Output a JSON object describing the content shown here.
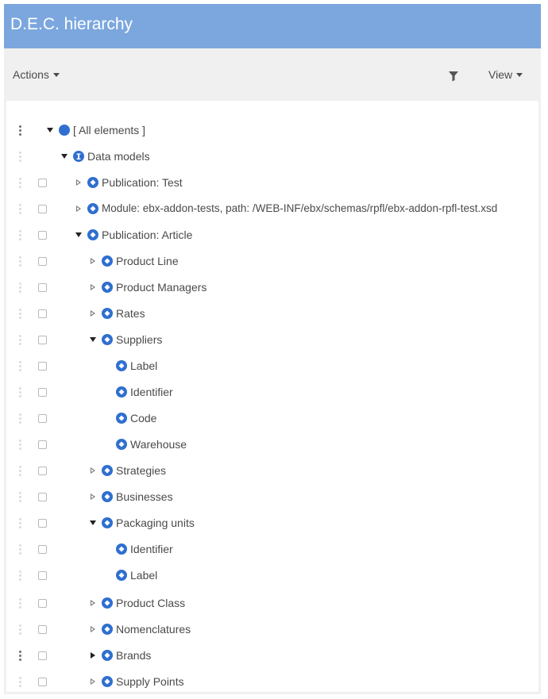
{
  "header": {
    "title": "D.E.C. hierarchy"
  },
  "toolbar": {
    "actions_label": "Actions",
    "view_label": "View"
  },
  "colors": {
    "header_bg": "#7ba7de",
    "node_icon": "#2f6fcf"
  },
  "tree": [
    {
      "label": "[ All elements ]",
      "icon": "circle-icon",
      "expander": "expanded"
    },
    {
      "label": "Data models",
      "icon": "info-icon",
      "expander": "expanded"
    },
    {
      "label": "Publication: Test",
      "icon": "node-icon",
      "expander": "collapsed"
    },
    {
      "label": "Module: ebx-addon-tests, path: /WEB-INF/ebx/schemas/rpfl/ebx-addon-rpfl-test.xsd",
      "icon": "node-icon",
      "expander": "collapsed"
    },
    {
      "label": "Publication: Article",
      "icon": "node-icon",
      "expander": "expanded"
    },
    {
      "label": "Product Line",
      "icon": "node-icon",
      "expander": "collapsed"
    },
    {
      "label": "Product Managers",
      "icon": "node-icon",
      "expander": "collapsed"
    },
    {
      "label": "Rates",
      "icon": "node-icon",
      "expander": "collapsed"
    },
    {
      "label": "Suppliers",
      "icon": "node-icon",
      "expander": "expanded"
    },
    {
      "label": "Label",
      "icon": "node-icon",
      "expander": "none"
    },
    {
      "label": "Identifier",
      "icon": "node-icon",
      "expander": "none"
    },
    {
      "label": "Code",
      "icon": "node-icon",
      "expander": "none"
    },
    {
      "label": "Warehouse",
      "icon": "node-icon",
      "expander": "none"
    },
    {
      "label": "Strategies",
      "icon": "node-icon",
      "expander": "collapsed"
    },
    {
      "label": "Businesses",
      "icon": "node-icon",
      "expander": "collapsed"
    },
    {
      "label": "Packaging units",
      "icon": "node-icon",
      "expander": "expanded"
    },
    {
      "label": "Identifier",
      "icon": "node-icon",
      "expander": "none"
    },
    {
      "label": "Label",
      "icon": "node-icon",
      "expander": "none"
    },
    {
      "label": "Product Class",
      "icon": "node-icon",
      "expander": "collapsed"
    },
    {
      "label": "Nomenclatures",
      "icon": "node-icon",
      "expander": "collapsed"
    },
    {
      "label": "Brands",
      "icon": "node-icon",
      "expander": "collapsed-active"
    },
    {
      "label": "Supply Points",
      "icon": "node-icon",
      "expander": "collapsed"
    }
  ]
}
